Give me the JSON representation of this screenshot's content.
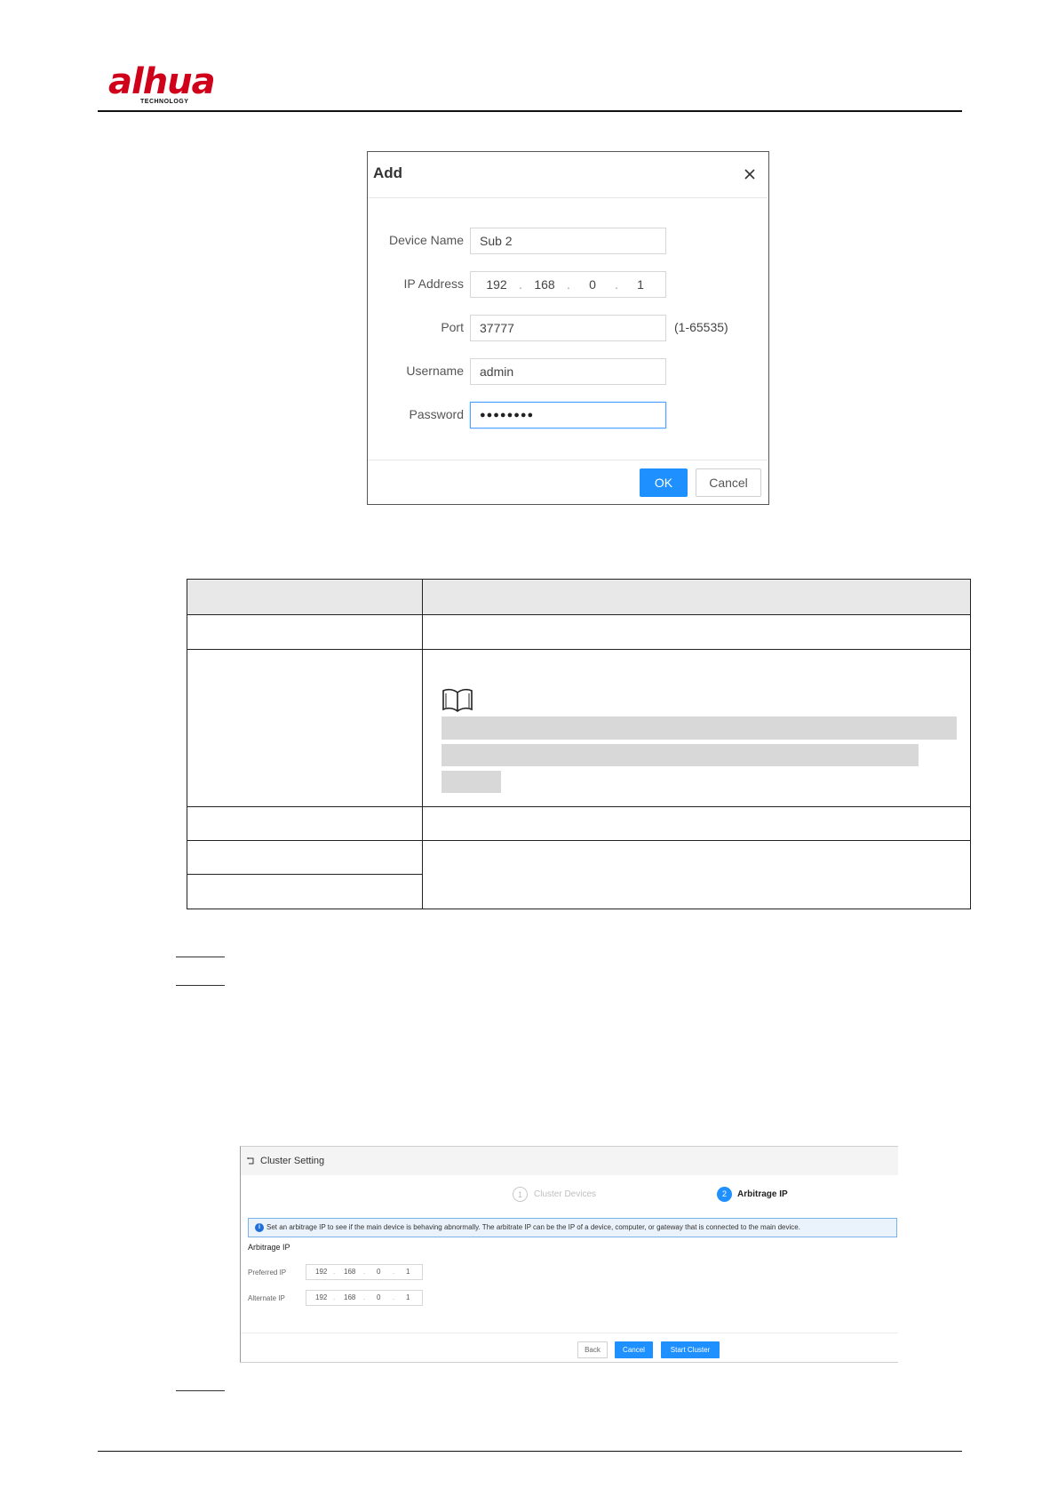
{
  "header": {
    "logo_text": "alhua",
    "logo_sub": "TECHNOLOGY"
  },
  "add_dialog": {
    "title": "Add",
    "device_name_label": "Device Name",
    "device_name_value": "Sub 2",
    "ip_label": "IP Address",
    "ip_octets": [
      "192",
      "168",
      "0",
      "1"
    ],
    "port_label": "Port",
    "port_value": "37777",
    "port_range": "(1-65535)",
    "username_label": "Username",
    "username_value": "admin",
    "password_label": "Password",
    "password_value": "●●●●●●●●",
    "ok_label": "OK",
    "cancel_label": "Cancel"
  },
  "cluster_setting": {
    "title": "Cluster Setting",
    "step1_num": "1",
    "step1_label": "Cluster Devices",
    "step2_num": "2",
    "step2_label": "Arbitrage IP",
    "info_text": "Set an arbitrage IP to see if the main device is behaving abnormally. The arbitrate IP can be the IP of a device, computer, or gateway that is connected to the main device.",
    "section_label": "Arbitrage IP",
    "preferred_label": "Preferred IP",
    "preferred_octets": [
      "192",
      "168",
      "0",
      "1"
    ],
    "alternate_label": "Alternate IP",
    "alternate_octets": [
      "192",
      "168",
      "0",
      "1"
    ],
    "back_label": "Back",
    "cancel_label": "Cancel",
    "start_label": "Start Cluster"
  }
}
